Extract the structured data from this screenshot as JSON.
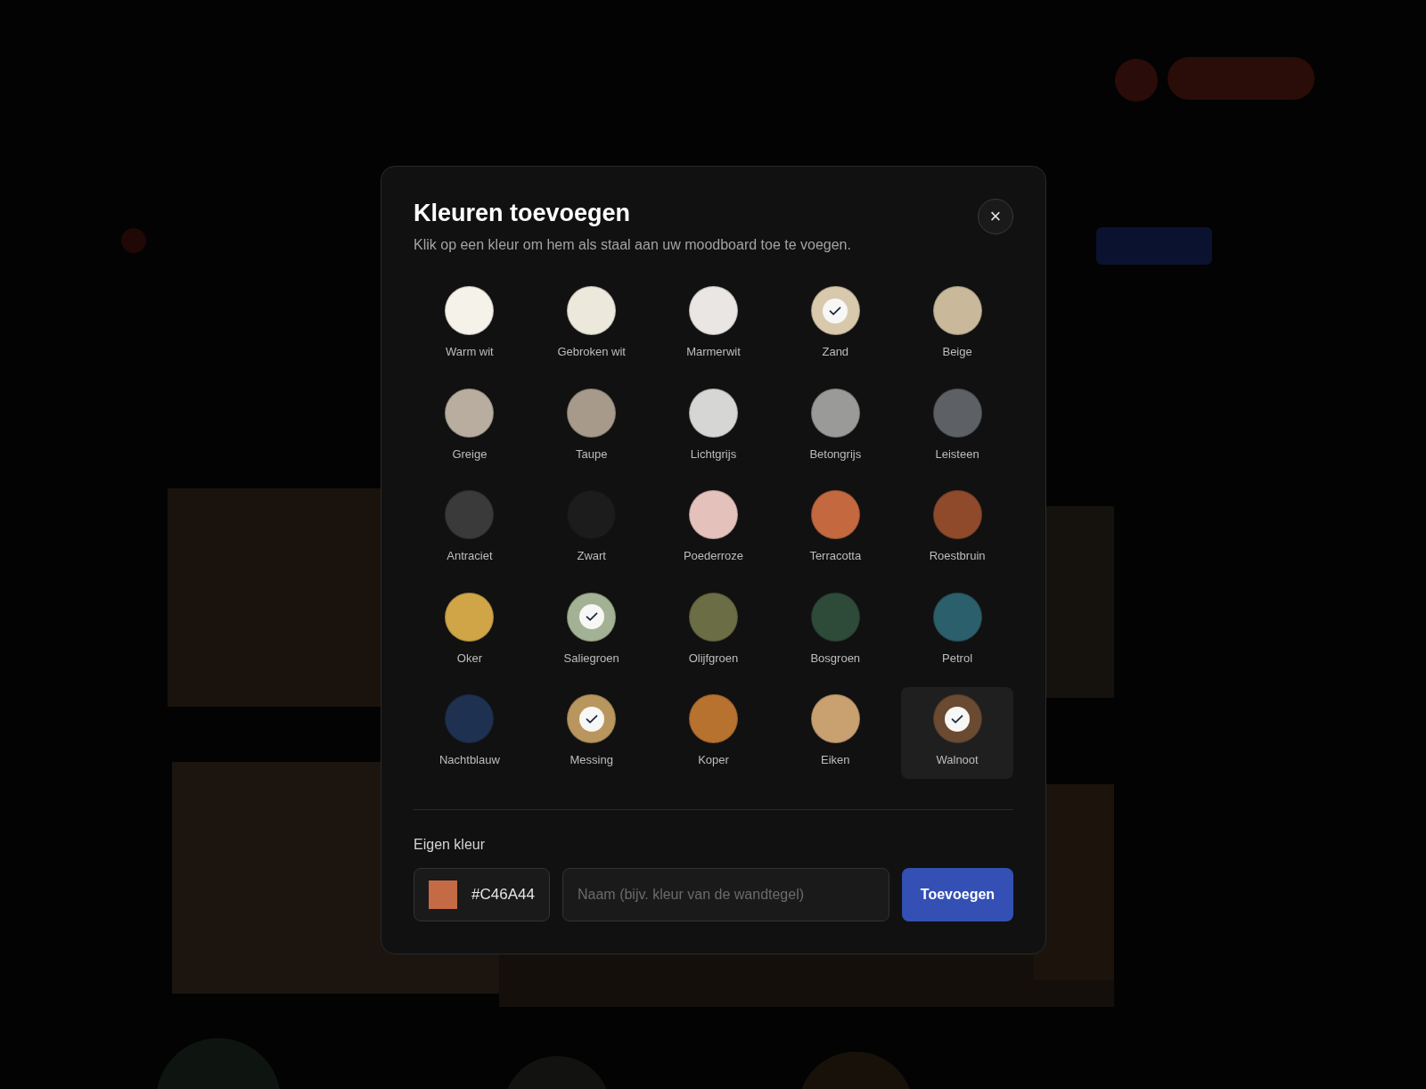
{
  "dialog": {
    "title": "Kleuren toevoegen",
    "subtitle": "Klik op een kleur om hem als staal aan uw moodboard toe te voegen.",
    "close_icon": "×",
    "colors": [
      {
        "name": "Warm wit",
        "color": "#f5f2ea",
        "checked": false,
        "highlighted": false
      },
      {
        "name": "Gebroken wit",
        "color": "#ede8dc",
        "checked": false,
        "highlighted": false
      },
      {
        "name": "Marmerwit",
        "color": "#e9e6e3",
        "checked": false,
        "highlighted": false
      },
      {
        "name": "Zand",
        "color": "#d8c9ad",
        "checked": true,
        "highlighted": false
      },
      {
        "name": "Beige",
        "color": "#c9b99a",
        "checked": false,
        "highlighted": false
      },
      {
        "name": "Greige",
        "color": "#b8ad9f",
        "checked": false,
        "highlighted": false
      },
      {
        "name": "Taupe",
        "color": "#a89a8b",
        "checked": false,
        "highlighted": false
      },
      {
        "name": "Lichtgrijs",
        "color": "#d6d6d4",
        "checked": false,
        "highlighted": false
      },
      {
        "name": "Betongrijs",
        "color": "#9a9a98",
        "checked": false,
        "highlighted": false
      },
      {
        "name": "Leisteen",
        "color": "#5d6065",
        "checked": false,
        "highlighted": false
      },
      {
        "name": "Antraciet",
        "color": "#3a3a3a",
        "checked": false,
        "highlighted": false
      },
      {
        "name": "Zwart",
        "color": "#1c1c1c",
        "checked": false,
        "highlighted": false
      },
      {
        "name": "Poederroze",
        "color": "#e4c2bb",
        "checked": false,
        "highlighted": false
      },
      {
        "name": "Terracotta",
        "color": "#c4683f",
        "checked": false,
        "highlighted": false
      },
      {
        "name": "Roestbruin",
        "color": "#8f4a2c",
        "checked": false,
        "highlighted": false
      },
      {
        "name": "Oker",
        "color": "#cfa548",
        "checked": false,
        "highlighted": false
      },
      {
        "name": "Saliegroen",
        "color": "#a3b295",
        "checked": true,
        "highlighted": false
      },
      {
        "name": "Olijfgroen",
        "color": "#6b6d45",
        "checked": false,
        "highlighted": false
      },
      {
        "name": "Bosgroen",
        "color": "#2e4a38",
        "checked": false,
        "highlighted": false
      },
      {
        "name": "Petrol",
        "color": "#2b5f6b",
        "checked": false,
        "highlighted": false
      },
      {
        "name": "Nachtblauw",
        "color": "#1f3150",
        "checked": false,
        "highlighted": false
      },
      {
        "name": "Messing",
        "color": "#b9965e",
        "checked": true,
        "highlighted": false
      },
      {
        "name": "Koper",
        "color": "#b8722f",
        "checked": false,
        "highlighted": false
      },
      {
        "name": "Eiken",
        "color": "#c9a070",
        "checked": false,
        "highlighted": false
      },
      {
        "name": "Walnoot",
        "color": "#6b4a32",
        "checked": true,
        "highlighted": true
      }
    ],
    "custom": {
      "label": "Eigen kleur",
      "color": "#c46a44",
      "hex": "#C46A44",
      "name_placeholder": "Naam (bijv. kleur van de wandtegel)",
      "button": "Toevoegen"
    }
  }
}
